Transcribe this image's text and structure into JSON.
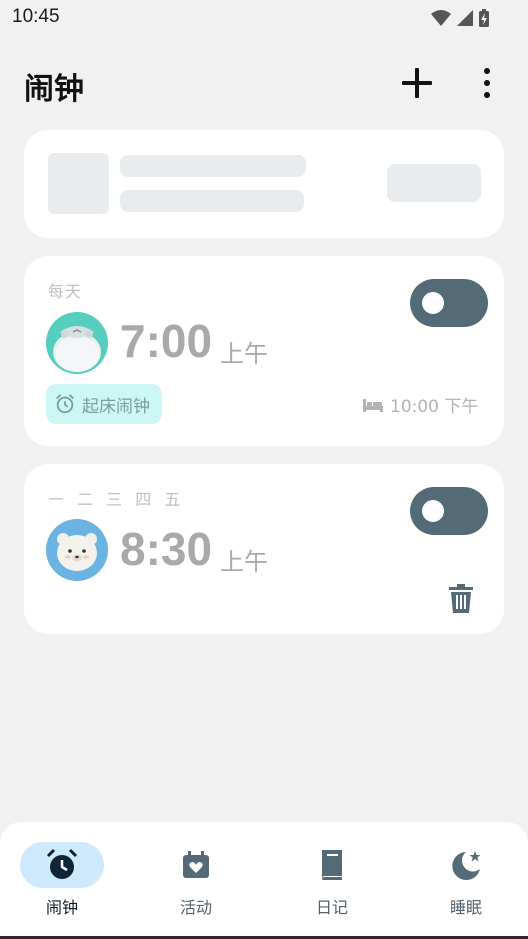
{
  "status_bar": {
    "time": "10:45",
    "icons": [
      "wifi-icon",
      "signal-icon",
      "battery-charging-icon"
    ]
  },
  "header": {
    "title": "闹钟",
    "add_icon": "plus-icon",
    "more_icon": "more-vert-icon"
  },
  "colors": {
    "background": "#f1f1f1",
    "card": "#ffffff",
    "toggle": "#556a77",
    "tag_bg": "#cdf7f4",
    "nav_active_bg": "#cde9fb",
    "avatar1_bg": "#55cdbf",
    "avatar2_bg": "#6ab3e2"
  },
  "alarms": [
    {
      "repeat": "每天",
      "time": "7:00",
      "period": "上午",
      "enabled": false,
      "avatar_icon": "polar-bear-avatar-icon",
      "tag_icon": "alarm-icon",
      "tag_label": "起床闹钟",
      "bedtime_icon": "bed-icon",
      "bedtime": "10:00 下午"
    },
    {
      "repeat": "一 二 三 四 五",
      "time": "8:30",
      "period": "上午",
      "enabled": false,
      "avatar_icon": "bear-avatar-icon",
      "delete_icon": "trash-icon"
    }
  ],
  "bottom_nav": [
    {
      "label": "闹钟",
      "icon": "alarm-clock-icon",
      "active": true
    },
    {
      "label": "活动",
      "icon": "calendar-heart-icon",
      "active": false
    },
    {
      "label": "日记",
      "icon": "book-icon",
      "active": false
    },
    {
      "label": "睡眠",
      "icon": "moon-star-icon",
      "active": false
    }
  ]
}
